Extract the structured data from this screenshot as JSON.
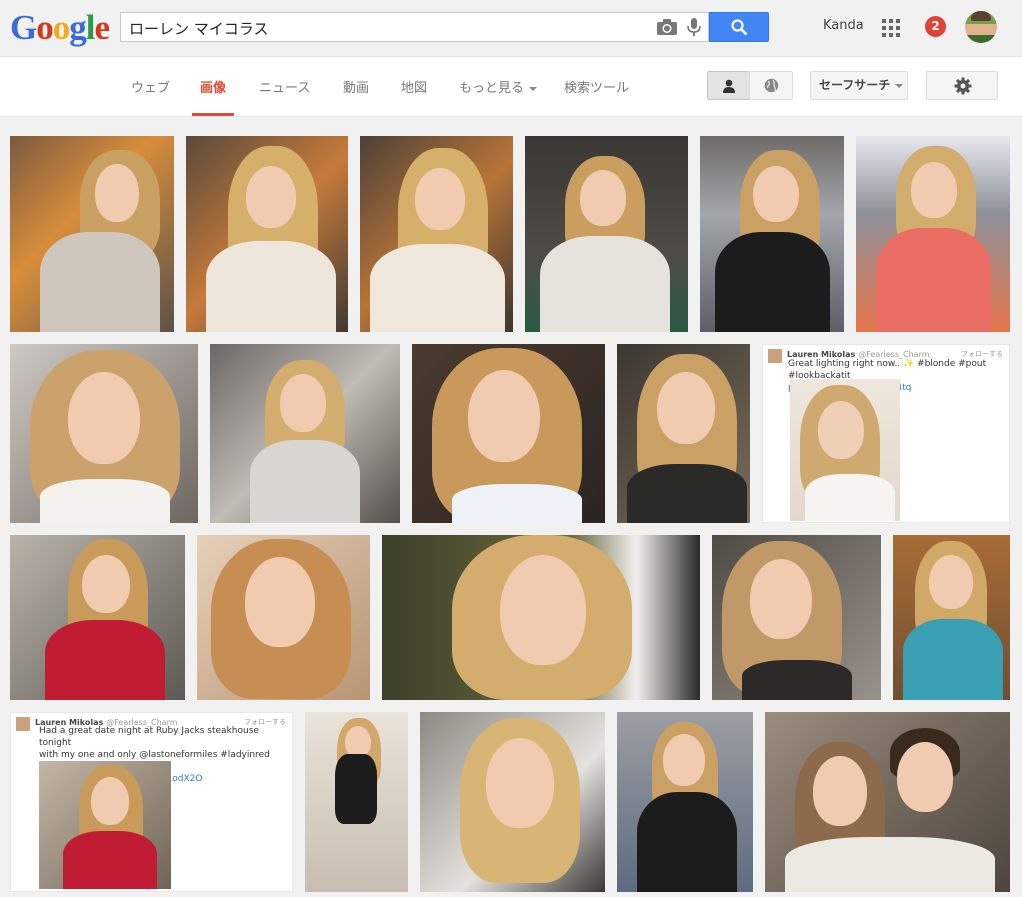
{
  "logo": {
    "letters": [
      "G",
      "o",
      "o",
      "g",
      "l",
      "e"
    ]
  },
  "search": {
    "query": "ローレン マイコラス"
  },
  "account": {
    "name": "Kanda",
    "notifications": "2"
  },
  "tabs": [
    "ウェブ",
    "画像",
    "ニュース",
    "動画",
    "地図",
    "もっと見る",
    "検索ツール"
  ],
  "active_tab": "画像",
  "toolbar": {
    "safesearch_label": "セーフサーチ"
  },
  "tweets": [
    {
      "author": "Lauren Mikolas",
      "handle": "@Fearless_Charm",
      "follow": "フォローする",
      "lines": [
        "Great lighting right now.. ✨ #blonde #pout #lookbackatit",
        "pic.twitter.com/0tHMfnh4tq"
      ]
    },
    {
      "author": "Lauren Mikolas",
      "handle": "@Fearless_Charm",
      "follow": "フォローする",
      "lines": [
        "Had a great date night at Ruby Jacks steakhouse tonight",
        "with my one and only @lastoneformiles #ladyinred #wine",
        "#meat pic.twitter.com/VXXT1odX2O"
      ]
    }
  ],
  "colors": {
    "accent": "#dd4b39",
    "search_blue": "#4285f4",
    "link_blue": "#2b7bb9",
    "hair_blonde": "#c9a062"
  }
}
